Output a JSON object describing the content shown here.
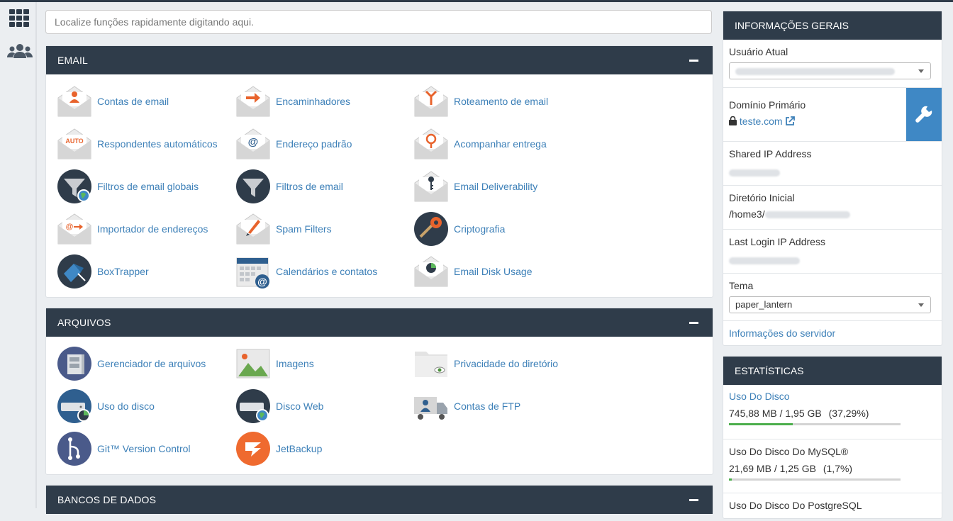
{
  "search": {
    "placeholder": "Localize funções rapidamente digitando aqui."
  },
  "sections": [
    {
      "title": "EMAIL",
      "items": [
        {
          "label": "Contas de email",
          "icon": "email-accounts-icon"
        },
        {
          "label": "Encaminhadores",
          "icon": "forwarders-icon"
        },
        {
          "label": "Roteamento de email",
          "icon": "email-routing-icon"
        },
        {
          "label": "Respondentes automáticos",
          "icon": "autoresponders-icon"
        },
        {
          "label": "Endereço padrão",
          "icon": "default-address-icon"
        },
        {
          "label": "Acompanhar entrega",
          "icon": "track-delivery-icon"
        },
        {
          "label": "Filtros de email globais",
          "icon": "global-filters-icon"
        },
        {
          "label": "Filtros de email",
          "icon": "email-filters-icon"
        },
        {
          "label": "Email Deliverability",
          "icon": "email-deliverability-icon"
        },
        {
          "label": "Importador de endereços",
          "icon": "address-importer-icon"
        },
        {
          "label": "Spam Filters",
          "icon": "spam-filters-icon"
        },
        {
          "label": "Criptografia",
          "icon": "encryption-icon"
        },
        {
          "label": "BoxTrapper",
          "icon": "boxtrapper-icon"
        },
        {
          "label": "Calendários e contatos",
          "icon": "calendars-contacts-icon"
        },
        {
          "label": "Email Disk Usage",
          "icon": "email-disk-usage-icon"
        }
      ]
    },
    {
      "title": "ARQUIVOS",
      "items": [
        {
          "label": "Gerenciador de arquivos",
          "icon": "file-manager-icon"
        },
        {
          "label": "Imagens",
          "icon": "images-icon"
        },
        {
          "label": "Privacidade do diretório",
          "icon": "directory-privacy-icon"
        },
        {
          "label": "Uso do disco",
          "icon": "disk-usage-icon"
        },
        {
          "label": "Disco Web",
          "icon": "web-disk-icon"
        },
        {
          "label": "Contas de FTP",
          "icon": "ftp-accounts-icon"
        },
        {
          "label": "Git™ Version Control",
          "icon": "git-icon"
        },
        {
          "label": "JetBackup",
          "icon": "jetbackup-icon"
        }
      ]
    },
    {
      "title": "BANCOS DE DADOS",
      "items": []
    }
  ],
  "general": {
    "title": "INFORMAÇÕES GERAIS",
    "current_user_label": "Usuário Atual",
    "primary_domain_label": "Domínio Primário",
    "primary_domain": "teste.com",
    "shared_ip_label": "Shared IP Address",
    "home_dir_label": "Diretório Inicial",
    "home_dir_prefix": "/home3/",
    "last_login_label": "Last Login IP Address",
    "theme_label": "Tema",
    "theme_value": "paper_lantern",
    "server_info_link": "Informações do servidor"
  },
  "stats": {
    "title": "ESTATÍSTICAS",
    "rows": [
      {
        "label": "Uso Do Disco",
        "value": "745,88 MB / 1,95 GB",
        "percent_text": "(37,29%)",
        "percent": 37.29
      },
      {
        "label": "Uso Do Disco Do MySQL®",
        "value": "21,69 MB / 1,25 GB",
        "percent_text": "(1,7%)",
        "percent": 1.7
      },
      {
        "label": "Uso Do Disco Do PostgreSQL"
      }
    ]
  }
}
